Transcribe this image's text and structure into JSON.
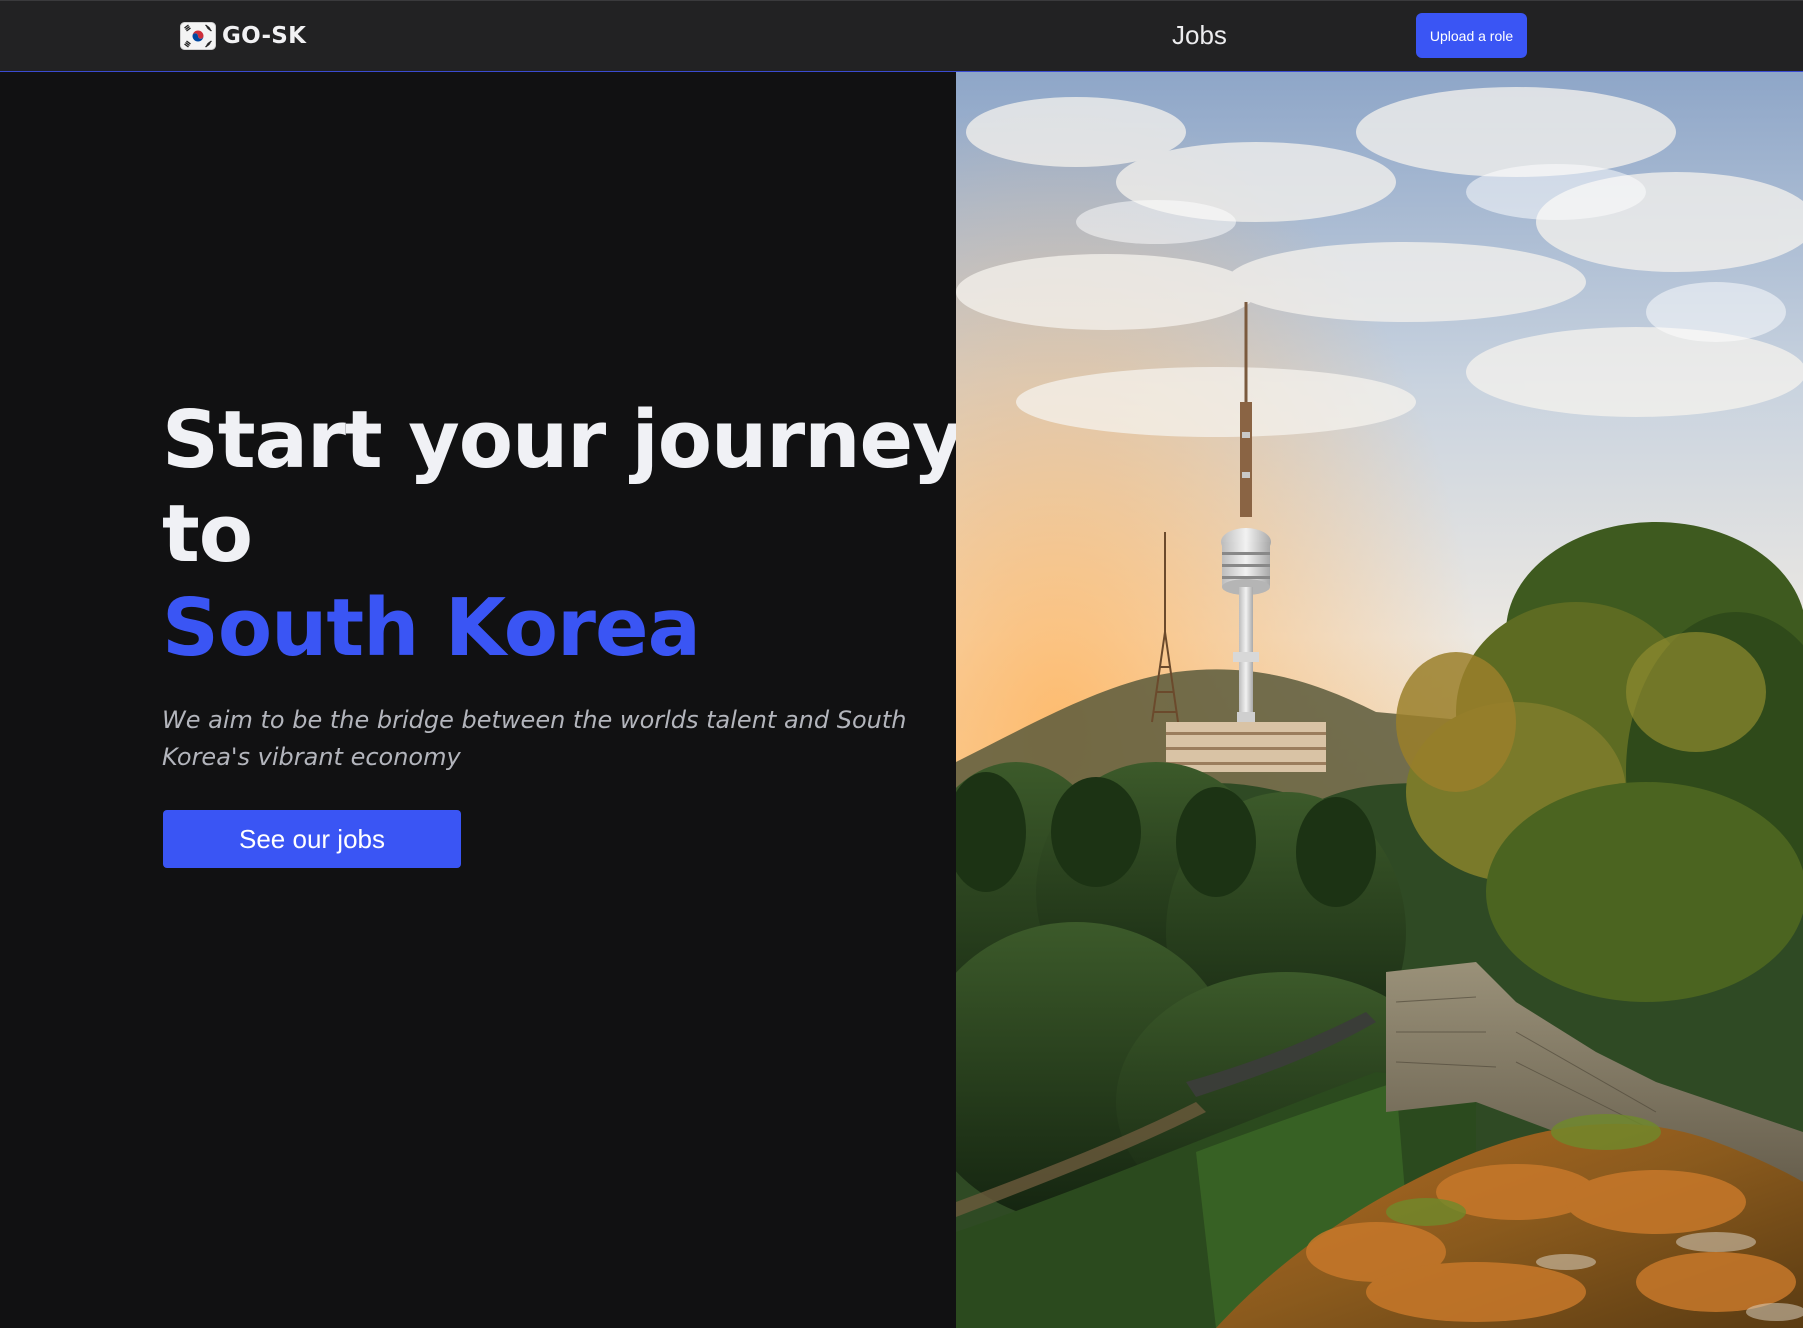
{
  "header": {
    "brand_name": "GO-SK",
    "nav_jobs": "Jobs",
    "upload_label": "Upload a role"
  },
  "hero": {
    "headline_line1": "Start your journey",
    "headline_line2": "to",
    "headline_accent": "South Korea",
    "tagline": "We aim to be the bridge between the worlds talent and South Korea's vibrant economy",
    "cta_label": "See our jobs"
  },
  "icons": {
    "brand": "south-korea-flag-icon"
  },
  "colors": {
    "accent": "#3a55f4",
    "background": "#111112",
    "header_bg": "#222223",
    "headline": "#f0f1f5",
    "tagline": "#b3b5bc"
  }
}
